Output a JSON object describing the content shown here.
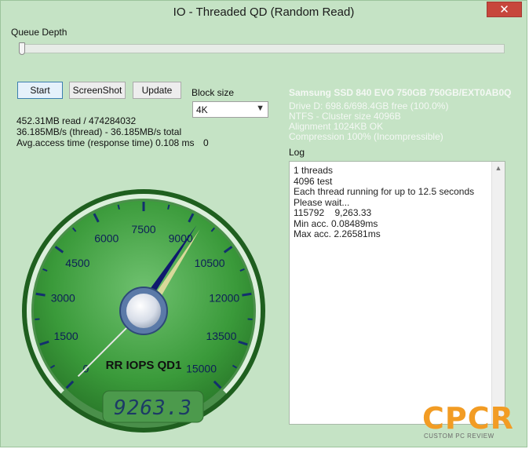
{
  "window": {
    "title": "IO - Threaded QD (Random Read)",
    "close_glyph": "✕"
  },
  "queue_depth": {
    "label": "Queue Depth",
    "value": 1
  },
  "buttons": {
    "start": "Start",
    "screenshot": "ScreenShot",
    "update": "Update"
  },
  "block_size": {
    "label": "Block size",
    "selected": "4K"
  },
  "stats": {
    "read": "452.31MB read / 474284032",
    "throughput": "36.185MB/s (thread) - 36.185MB/s total",
    "access_time": "Avg.access time (response time) 0.108 ms",
    "extra_value": "0"
  },
  "drive": {
    "name": "Samsung SSD 840 EVO 750GB 750GB/EXT0AB0Q",
    "free": "Drive D: 698.6/698.4GB free (100.0%)",
    "fs": "NTFS - Cluster size 4096B",
    "alignment": "Alignment 1024KB OK",
    "compression": "Compression 100% (Incompressible)"
  },
  "log": {
    "label": "Log",
    "lines": [
      "1 threads",
      "4096 test",
      "Each thread running for up to 12.5 seconds",
      "Please wait...",
      "115792    9,263.33",
      "Min acc. 0.08489ms",
      "Max acc. 2.26581ms"
    ]
  },
  "gauge": {
    "label": "RR IOPS QD1",
    "digital": "9263.3",
    "value": 9263.3,
    "min": 0,
    "max": 15000,
    "ticks": [
      "0",
      "1500",
      "3000",
      "4500",
      "6000",
      "7500",
      "9000",
      "10500",
      "12000",
      "13500",
      "15000"
    ]
  },
  "watermark": {
    "big": "CPCR",
    "small": "CUSTOM PC REVIEW"
  },
  "colors": {
    "background": "#c5e3c5",
    "gauge_face": "#3f9f3f",
    "needle": "#0f1a6e",
    "accent": "#f29c24"
  }
}
